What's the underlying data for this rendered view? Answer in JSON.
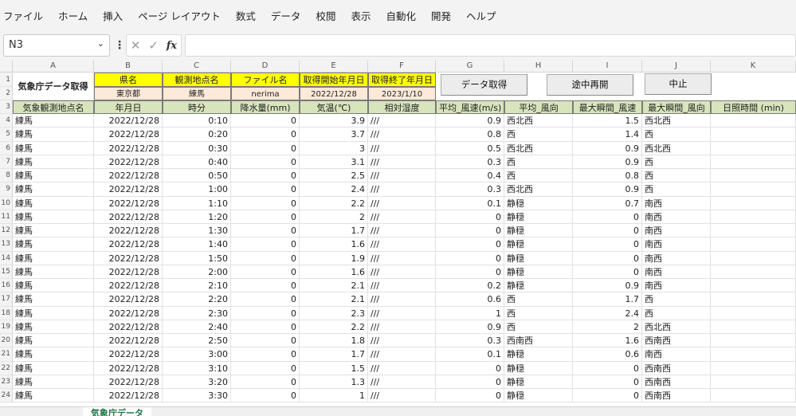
{
  "menu": [
    "ファイル",
    "ホーム",
    "挿入",
    "ページ レイアウト",
    "数式",
    "データ",
    "校閲",
    "表示",
    "自動化",
    "開発",
    "ヘルプ"
  ],
  "formula_bar": {
    "name_box": "N3",
    "fx": "fx",
    "content": ""
  },
  "columns": [
    "A",
    "B",
    "C",
    "D",
    "E",
    "F",
    "G",
    "H",
    "I",
    "J",
    "K"
  ],
  "header1": {
    "title": "気象庁データ取得",
    "pref_label": "県名",
    "station_label": "観測地点名",
    "file_label": "ファイル名",
    "start_label": "取得開始年月日",
    "end_label": "取得終了年月日",
    "pref_value": "東京都",
    "station_value": "練馬",
    "file_value": "nerima",
    "start_value": "2022/12/28",
    "end_value": "2023/1/10"
  },
  "buttons": {
    "fetch": "データ取得",
    "resume": "途中再開",
    "stop": "中止"
  },
  "table_headers": [
    "気象観測地点名",
    "年月日",
    "時分",
    "降水量(mm)",
    "気温(℃)",
    "相対湿度",
    "平均_風速(m/s)",
    "平均_風向",
    "最大瞬間_風速",
    "最大瞬間_風向",
    "日照時間 (min)"
  ],
  "rows": [
    [
      "練馬",
      "2022/12/28",
      "0:10",
      "0",
      "3.9",
      "///",
      "0.9",
      "西北西",
      "1.5",
      "西北西",
      ""
    ],
    [
      "練馬",
      "2022/12/28",
      "0:20",
      "0",
      "3.7",
      "///",
      "0.8",
      "西",
      "1.4",
      "西",
      ""
    ],
    [
      "練馬",
      "2022/12/28",
      "0:30",
      "0",
      "3",
      "///",
      "0.5",
      "西北西",
      "0.9",
      "西北西",
      ""
    ],
    [
      "練馬",
      "2022/12/28",
      "0:40",
      "0",
      "3.1",
      "///",
      "0.3",
      "西",
      "0.9",
      "西",
      ""
    ],
    [
      "練馬",
      "2022/12/28",
      "0:50",
      "0",
      "2.5",
      "///",
      "0.4",
      "西",
      "0.8",
      "西",
      ""
    ],
    [
      "練馬",
      "2022/12/28",
      "1:00",
      "0",
      "2.4",
      "///",
      "0.3",
      "西北西",
      "0.9",
      "西",
      ""
    ],
    [
      "練馬",
      "2022/12/28",
      "1:10",
      "0",
      "2.2",
      "///",
      "0.1",
      "静穏",
      "0.7",
      "南西",
      ""
    ],
    [
      "練馬",
      "2022/12/28",
      "1:20",
      "0",
      "2",
      "///",
      "0",
      "静穏",
      "0",
      "南西",
      ""
    ],
    [
      "練馬",
      "2022/12/28",
      "1:30",
      "0",
      "1.7",
      "///",
      "0",
      "静穏",
      "0",
      "南西",
      ""
    ],
    [
      "練馬",
      "2022/12/28",
      "1:40",
      "0",
      "1.6",
      "///",
      "0",
      "静穏",
      "0",
      "南西",
      ""
    ],
    [
      "練馬",
      "2022/12/28",
      "1:50",
      "0",
      "1.9",
      "///",
      "0",
      "静穏",
      "0",
      "南西",
      ""
    ],
    [
      "練馬",
      "2022/12/28",
      "2:00",
      "0",
      "1.6",
      "///",
      "0",
      "静穏",
      "0",
      "南西",
      ""
    ],
    [
      "練馬",
      "2022/12/28",
      "2:10",
      "0",
      "2.1",
      "///",
      "0.2",
      "静穏",
      "0.9",
      "南西",
      ""
    ],
    [
      "練馬",
      "2022/12/28",
      "2:20",
      "0",
      "2.1",
      "///",
      "0.6",
      "西",
      "1.7",
      "西",
      ""
    ],
    [
      "練馬",
      "2022/12/28",
      "2:30",
      "0",
      "2.3",
      "///",
      "1",
      "西",
      "2.4",
      "西",
      ""
    ],
    [
      "練馬",
      "2022/12/28",
      "2:40",
      "0",
      "2.2",
      "///",
      "0.9",
      "西",
      "2",
      "西北西",
      ""
    ],
    [
      "練馬",
      "2022/12/28",
      "2:50",
      "0",
      "1.8",
      "///",
      "0.3",
      "西南西",
      "1.6",
      "西南西",
      ""
    ],
    [
      "練馬",
      "2022/12/28",
      "3:00",
      "0",
      "1.7",
      "///",
      "0.1",
      "静穏",
      "0.6",
      "南西",
      ""
    ],
    [
      "練馬",
      "2022/12/28",
      "3:10",
      "0",
      "1.5",
      "///",
      "0",
      "静穏",
      "0",
      "西南西",
      ""
    ],
    [
      "練馬",
      "2022/12/28",
      "3:20",
      "0",
      "1.3",
      "///",
      "0",
      "静穏",
      "0",
      "西南西",
      ""
    ],
    [
      "練馬",
      "2022/12/28",
      "3:30",
      "0",
      "1",
      "///",
      "0",
      "静穏",
      "0",
      "西南西",
      ""
    ]
  ],
  "sheet_tabs": {
    "active": "気象庁データ"
  }
}
